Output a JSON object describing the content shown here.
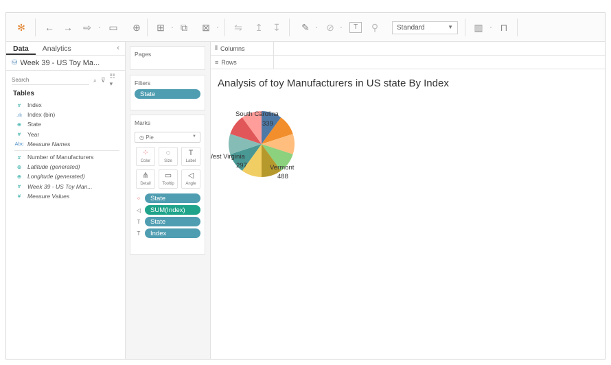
{
  "toolbar": {
    "view_mode": "Standard",
    "icons": [
      "tableau-logo-icon",
      "undo-icon",
      "redo-icon",
      "replay-icon",
      "save-icon",
      "new-datasource-icon",
      "new-worksheet-icon",
      "duplicate-icon",
      "clear-icon",
      "swap-icon",
      "sort-asc-icon",
      "sort-desc-icon",
      "highlight-icon",
      "group-icon",
      "label-icon",
      "pin-icon",
      "show-me-icon",
      "presentation-icon"
    ]
  },
  "data_pane": {
    "tab_data": "Data",
    "tab_analytics": "Analytics",
    "datasource_name": "Week 39 - US Toy Ma...",
    "search_placeholder": "Search",
    "tables_heading": "Tables",
    "dimensions": [
      {
        "icon": "#",
        "label": "Index"
      },
      {
        "icon": ".ılı",
        "label": "Index (bin)"
      },
      {
        "icon": "⊕",
        "label": "State"
      },
      {
        "icon": "#",
        "label": "Year"
      },
      {
        "icon": "Abc",
        "label": "Measure Names"
      }
    ],
    "measures": [
      {
        "icon": "#",
        "label": "Number of Manufacturers"
      },
      {
        "icon": "⊕",
        "label": "Latitude (generated)"
      },
      {
        "icon": "⊕",
        "label": "Longitude (generated)"
      },
      {
        "icon": "#",
        "label": "Week 39 - US Toy Man..."
      },
      {
        "icon": "#",
        "label": "Measure Values"
      }
    ]
  },
  "shelves": {
    "pages_label": "Pages",
    "filters_label": "Filters",
    "filter_pill": "State",
    "marks_label": "Marks",
    "mark_type": "Pie",
    "mark_buttons": [
      {
        "icon": "⁘",
        "label": "Color"
      },
      {
        "icon": "◌",
        "label": "Size"
      },
      {
        "icon": "T",
        "label": "Label"
      },
      {
        "icon": "⋔",
        "label": "Detail"
      },
      {
        "icon": "▭",
        "label": "Tooltip"
      },
      {
        "icon": "◁",
        "label": "Angle"
      }
    ],
    "mark_pills": [
      {
        "icon": "⁘",
        "label": "State",
        "kind": "dim"
      },
      {
        "icon": "◁",
        "label": "SUM(Index)",
        "kind": "meas"
      },
      {
        "icon": "T",
        "label": "State",
        "kind": "dim"
      },
      {
        "icon": "T",
        "label": "Index",
        "kind": "dim"
      }
    ]
  },
  "view": {
    "columns_label": "Columns",
    "rows_label": "Rows",
    "title": "Analysis of toy Manufacturers in US state By Index"
  },
  "chart_data": {
    "type": "pie",
    "title": "Analysis of toy Manufacturers in US state By Index",
    "slices": [
      {
        "color": "#4e79a7",
        "value": null
      },
      {
        "color": "#f28e2b",
        "value": null
      },
      {
        "color": "#ffbe7d",
        "value": null
      },
      {
        "color": "#8cd17d",
        "value": null
      },
      {
        "color": "#b6992d",
        "value": null
      },
      {
        "color": "#f1ce63",
        "value": null
      },
      {
        "color": "#499894",
        "value": null
      },
      {
        "color": "#86bcb6",
        "value": null
      },
      {
        "color": "#e15759",
        "value": null
      },
      {
        "color": "#ff9d9a",
        "value": null
      }
    ],
    "labels": [
      {
        "state": "South Carolina",
        "value": 339
      },
      {
        "state": "West Virginia",
        "value": 297
      },
      {
        "state": "Vermont",
        "value": 488
      }
    ]
  }
}
